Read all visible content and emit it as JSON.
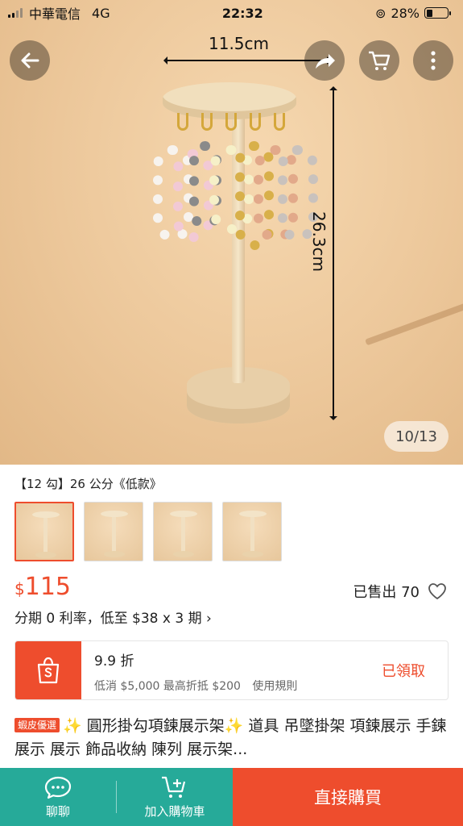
{
  "status_bar": {
    "carrier": "中華電信",
    "network": "4G",
    "time": "22:32",
    "battery_text": "28%",
    "battery_level": 0.28
  },
  "hero": {
    "width_label": "11.5cm",
    "height_label": "26.3cm",
    "counter": "10/13",
    "icons": {
      "back": "back-arrow-icon",
      "share": "share-icon",
      "cart": "cart-icon",
      "more": "more-vertical-icon"
    }
  },
  "variation": {
    "selected_label": "【12 勾】26 公分《低款》",
    "thumbnails": [
      "variant-1",
      "variant-2",
      "variant-3",
      "variant-4"
    ],
    "selected_index": 0
  },
  "price": {
    "currency": "$",
    "amount": "115",
    "sold": "已售出 70",
    "installment": "分期 0 利率，低至 $38 x 3 期 ›"
  },
  "voucher": {
    "title": "9.9 折",
    "subtitle": "低消 $5,000 最高折抵 $200",
    "rules_link": "使用規則",
    "status": "已領取"
  },
  "product": {
    "badge": "蝦皮優選",
    "title": "✨ 圓形掛勾項鍊展示架✨ 道具 吊墜掛架 項鍊展示 手鍊展示 展示 飾品收納 陳列 展示架..."
  },
  "bottom_bar": {
    "chat_label": "聊聊",
    "cart_label": "加入購物車",
    "buy_label": "直接購買"
  },
  "colors": {
    "brand": "#ee4d2d",
    "teal": "#26aa99"
  }
}
